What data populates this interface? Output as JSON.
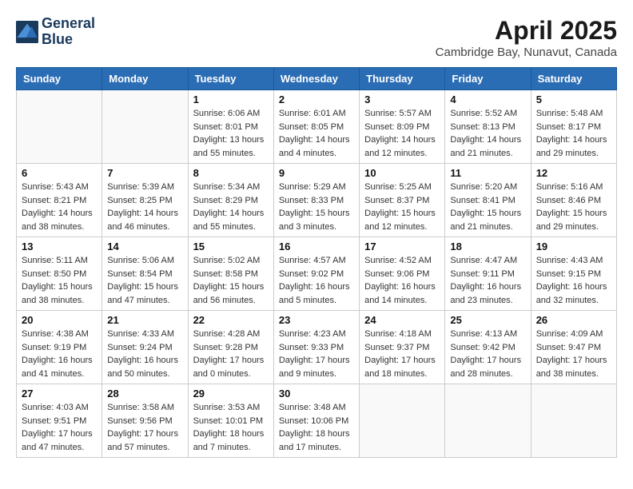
{
  "header": {
    "logo_line1": "General",
    "logo_line2": "Blue",
    "month_title": "April 2025",
    "location": "Cambridge Bay, Nunavut, Canada"
  },
  "weekdays": [
    "Sunday",
    "Monday",
    "Tuesday",
    "Wednesday",
    "Thursday",
    "Friday",
    "Saturday"
  ],
  "weeks": [
    [
      {
        "day": "",
        "sunrise": "",
        "sunset": "",
        "daylight": ""
      },
      {
        "day": "",
        "sunrise": "",
        "sunset": "",
        "daylight": ""
      },
      {
        "day": "1",
        "sunrise": "Sunrise: 6:06 AM",
        "sunset": "Sunset: 8:01 PM",
        "daylight": "Daylight: 13 hours and 55 minutes."
      },
      {
        "day": "2",
        "sunrise": "Sunrise: 6:01 AM",
        "sunset": "Sunset: 8:05 PM",
        "daylight": "Daylight: 14 hours and 4 minutes."
      },
      {
        "day": "3",
        "sunrise": "Sunrise: 5:57 AM",
        "sunset": "Sunset: 8:09 PM",
        "daylight": "Daylight: 14 hours and 12 minutes."
      },
      {
        "day": "4",
        "sunrise": "Sunrise: 5:52 AM",
        "sunset": "Sunset: 8:13 PM",
        "daylight": "Daylight: 14 hours and 21 minutes."
      },
      {
        "day": "5",
        "sunrise": "Sunrise: 5:48 AM",
        "sunset": "Sunset: 8:17 PM",
        "daylight": "Daylight: 14 hours and 29 minutes."
      }
    ],
    [
      {
        "day": "6",
        "sunrise": "Sunrise: 5:43 AM",
        "sunset": "Sunset: 8:21 PM",
        "daylight": "Daylight: 14 hours and 38 minutes."
      },
      {
        "day": "7",
        "sunrise": "Sunrise: 5:39 AM",
        "sunset": "Sunset: 8:25 PM",
        "daylight": "Daylight: 14 hours and 46 minutes."
      },
      {
        "day": "8",
        "sunrise": "Sunrise: 5:34 AM",
        "sunset": "Sunset: 8:29 PM",
        "daylight": "Daylight: 14 hours and 55 minutes."
      },
      {
        "day": "9",
        "sunrise": "Sunrise: 5:29 AM",
        "sunset": "Sunset: 8:33 PM",
        "daylight": "Daylight: 15 hours and 3 minutes."
      },
      {
        "day": "10",
        "sunrise": "Sunrise: 5:25 AM",
        "sunset": "Sunset: 8:37 PM",
        "daylight": "Daylight: 15 hours and 12 minutes."
      },
      {
        "day": "11",
        "sunrise": "Sunrise: 5:20 AM",
        "sunset": "Sunset: 8:41 PM",
        "daylight": "Daylight: 15 hours and 21 minutes."
      },
      {
        "day": "12",
        "sunrise": "Sunrise: 5:16 AM",
        "sunset": "Sunset: 8:46 PM",
        "daylight": "Daylight: 15 hours and 29 minutes."
      }
    ],
    [
      {
        "day": "13",
        "sunrise": "Sunrise: 5:11 AM",
        "sunset": "Sunset: 8:50 PM",
        "daylight": "Daylight: 15 hours and 38 minutes."
      },
      {
        "day": "14",
        "sunrise": "Sunrise: 5:06 AM",
        "sunset": "Sunset: 8:54 PM",
        "daylight": "Daylight: 15 hours and 47 minutes."
      },
      {
        "day": "15",
        "sunrise": "Sunrise: 5:02 AM",
        "sunset": "Sunset: 8:58 PM",
        "daylight": "Daylight: 15 hours and 56 minutes."
      },
      {
        "day": "16",
        "sunrise": "Sunrise: 4:57 AM",
        "sunset": "Sunset: 9:02 PM",
        "daylight": "Daylight: 16 hours and 5 minutes."
      },
      {
        "day": "17",
        "sunrise": "Sunrise: 4:52 AM",
        "sunset": "Sunset: 9:06 PM",
        "daylight": "Daylight: 16 hours and 14 minutes."
      },
      {
        "day": "18",
        "sunrise": "Sunrise: 4:47 AM",
        "sunset": "Sunset: 9:11 PM",
        "daylight": "Daylight: 16 hours and 23 minutes."
      },
      {
        "day": "19",
        "sunrise": "Sunrise: 4:43 AM",
        "sunset": "Sunset: 9:15 PM",
        "daylight": "Daylight: 16 hours and 32 minutes."
      }
    ],
    [
      {
        "day": "20",
        "sunrise": "Sunrise: 4:38 AM",
        "sunset": "Sunset: 9:19 PM",
        "daylight": "Daylight: 16 hours and 41 minutes."
      },
      {
        "day": "21",
        "sunrise": "Sunrise: 4:33 AM",
        "sunset": "Sunset: 9:24 PM",
        "daylight": "Daylight: 16 hours and 50 minutes."
      },
      {
        "day": "22",
        "sunrise": "Sunrise: 4:28 AM",
        "sunset": "Sunset: 9:28 PM",
        "daylight": "Daylight: 17 hours and 0 minutes."
      },
      {
        "day": "23",
        "sunrise": "Sunrise: 4:23 AM",
        "sunset": "Sunset: 9:33 PM",
        "daylight": "Daylight: 17 hours and 9 minutes."
      },
      {
        "day": "24",
        "sunrise": "Sunrise: 4:18 AM",
        "sunset": "Sunset: 9:37 PM",
        "daylight": "Daylight: 17 hours and 18 minutes."
      },
      {
        "day": "25",
        "sunrise": "Sunrise: 4:13 AM",
        "sunset": "Sunset: 9:42 PM",
        "daylight": "Daylight: 17 hours and 28 minutes."
      },
      {
        "day": "26",
        "sunrise": "Sunrise: 4:09 AM",
        "sunset": "Sunset: 9:47 PM",
        "daylight": "Daylight: 17 hours and 38 minutes."
      }
    ],
    [
      {
        "day": "27",
        "sunrise": "Sunrise: 4:03 AM",
        "sunset": "Sunset: 9:51 PM",
        "daylight": "Daylight: 17 hours and 47 minutes."
      },
      {
        "day": "28",
        "sunrise": "Sunrise: 3:58 AM",
        "sunset": "Sunset: 9:56 PM",
        "daylight": "Daylight: 17 hours and 57 minutes."
      },
      {
        "day": "29",
        "sunrise": "Sunrise: 3:53 AM",
        "sunset": "Sunset: 10:01 PM",
        "daylight": "Daylight: 18 hours and 7 minutes."
      },
      {
        "day": "30",
        "sunrise": "Sunrise: 3:48 AM",
        "sunset": "Sunset: 10:06 PM",
        "daylight": "Daylight: 18 hours and 17 minutes."
      },
      {
        "day": "",
        "sunrise": "",
        "sunset": "",
        "daylight": ""
      },
      {
        "day": "",
        "sunrise": "",
        "sunset": "",
        "daylight": ""
      },
      {
        "day": "",
        "sunrise": "",
        "sunset": "",
        "daylight": ""
      }
    ]
  ]
}
